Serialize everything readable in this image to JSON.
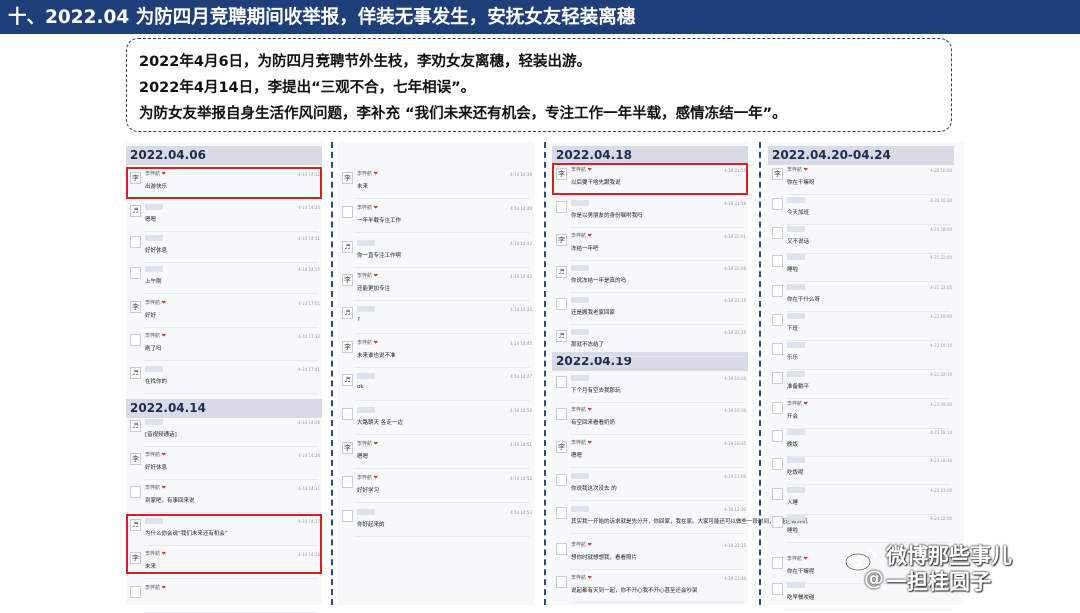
{
  "header": {
    "title": "十、2022.04  为防四月竞聘期间收举报，佯装无事发生，安抚女友轻装离穗"
  },
  "summary": {
    "line1": "2022年4月6日，为防四月竞聘节外生枝，李劝女友离穗，轻装出游。",
    "line2": "2022年4月14日，李提出“三观不合，七年相误”。",
    "line3": "为防女友举报自身生活作风问题，李补充 “我们未来还有机会，专注工作一年半载，感情冻结一年”。"
  },
  "dates": {
    "d1": "2022.04.06",
    "d2": "2022.04.14",
    "d3": "2022.04.18",
    "d4": "2022.04.19",
    "d5": "2022.04.20-04.24"
  },
  "sender": "李梓航",
  "columns": [
    {
      "messages": [
        {
          "name": "李梓航",
          "text": "出游快乐",
          "time": "4-14 14:32",
          "av": "李"
        },
        {
          "name": "",
          "text": "嗯嗯",
          "time": "4-14 14:35",
          "av": "♬"
        },
        {
          "name": "",
          "text": "好好休息",
          "time": "4-14 14:51",
          "av": ""
        },
        {
          "name": "",
          "text": "上午刚",
          "time": "4-14 14:55",
          "av": ""
        },
        {
          "name": "李梓航",
          "text": "好好",
          "time": "4-14 17:01",
          "av": "李"
        },
        {
          "name": "李梓航",
          "text": "刷了吗",
          "time": "4-14 17:32",
          "av": ""
        },
        {
          "name": "",
          "text": "在找你的",
          "time": "4-14 17:41",
          "av": "♬"
        },
        {
          "name": "",
          "text": "[音视频通话]",
          "time": "4-14 14:26",
          "av": "♬"
        },
        {
          "name": "李梓航",
          "text": "好好休息",
          "time": "4-14 14:28",
          "av": "李"
        },
        {
          "name": "李梓航",
          "text": "到家吧，有事回来说",
          "time": "4-14 14:31",
          "av": ""
        },
        {
          "name": "",
          "text": "为什么你会说“我们未来还有机会”",
          "time": "4-14 14:37",
          "av": "♬"
        },
        {
          "name": "李梓航",
          "text": "未来",
          "time": "4-14 14:38",
          "av": "李"
        },
        {
          "name": "李梓航",
          "text": "",
          "time": "",
          "av": ""
        }
      ]
    },
    {
      "messages": [
        {
          "name": "李梓航",
          "text": "未来",
          "time": "4-14 14:39",
          "av": "李"
        },
        {
          "name": "李梓航",
          "text": "一年半载专注工作",
          "time": "4-14 14:40",
          "av": ""
        },
        {
          "name": "",
          "text": "你一直专注工作啊",
          "time": "4-14 14:42",
          "av": "♬"
        },
        {
          "name": "李梓航",
          "text": "还能更加专注",
          "time": "4-14 14:43",
          "av": "李"
        },
        {
          "name": "",
          "text": "?",
          "time": "4-14 14:44",
          "av": "♬"
        },
        {
          "name": "李梓航",
          "text": "未来谁也说不准",
          "time": "4-14 14:45",
          "av": "李"
        },
        {
          "name": "",
          "text": "ok",
          "time": "4-14 14:47",
          "av": "♬"
        },
        {
          "name": "",
          "text": "大路朝天 各走一边",
          "time": "4-14 14:50",
          "av": ""
        },
        {
          "name": "李梓航",
          "text": "嗯嗯",
          "time": "4-14 14:51",
          "av": "李"
        },
        {
          "name": "李梓航",
          "text": "好好学习",
          "time": "4-14 14:52",
          "av": ""
        },
        {
          "name": "",
          "text": "你好起来的",
          "time": "4-14 14:53",
          "av": ""
        }
      ]
    },
    {
      "messages": [
        {
          "name": "李梓航",
          "text": "以后要干啥先跟我说",
          "time": "4-18 21:55",
          "av": "李"
        },
        {
          "name": "",
          "text": "你是以男朋友的身份嘱咐我吗",
          "time": "4-18 21:58",
          "av": ""
        },
        {
          "name": "李梓航",
          "text": "冻结一年吧",
          "time": "4-18 22:01",
          "av": "李"
        },
        {
          "name": "",
          "text": "你说冻结一年是真的吗",
          "time": "4-18 22:06",
          "av": "♬"
        },
        {
          "name": "",
          "text": "还是搬我老家回家",
          "time": "4-18 22:15",
          "av": ""
        },
        {
          "name": "",
          "text": "那就不冻结了",
          "time": "4-18 22:25",
          "av": "♬"
        },
        {
          "name": "",
          "text": "下个月有空去我那玩",
          "time": "4-19 10:20",
          "av": ""
        },
        {
          "name": "李梓航",
          "text": "有空回来看看奶奶",
          "time": "4-19 10:30",
          "av": ""
        },
        {
          "name": "李梓航",
          "text": "嗯嗯",
          "time": "4-19 10:35",
          "av": "李"
        },
        {
          "name": "",
          "text": "你说我这次没去        的",
          "time": "4-19 11:00",
          "av": ""
        },
        {
          "name": "",
          "text": "其实我一开始的诉求就是先分开，你回家，我在家。大家可能还可以做些一段时间，可能还有转机",
          "time": "4-19 12:30",
          "av": ""
        },
        {
          "name": "李梓航",
          "text": "想你时就想想我，看看照片",
          "time": "4-19 22:35",
          "av": ""
        },
        {
          "name": "李梓航",
          "text": "说起都有天到一起，你不开心我不开心甚至还会吵架",
          "time": "4-19 22:40",
          "av": ""
        }
      ]
    },
    {
      "messages": [
        {
          "name": "李梓航",
          "text": "你在干嘛呀",
          "time": "4-20 10:00",
          "av": "李"
        },
        {
          "name": "",
          "text": "今天加班",
          "time": "4-20 10:30",
          "av": ""
        },
        {
          "name": "",
          "text": "又不说话",
          "time": "4-20 18:00",
          "av": ""
        },
        {
          "name": "",
          "text": "睡啦",
          "time": "4-21 22:00",
          "av": ""
        },
        {
          "name": "",
          "text": "你在干什么呀",
          "time": "4-21 22:05",
          "av": ""
        },
        {
          "name": "",
          "text": "下班",
          "time": "4-22 19:00",
          "av": ""
        },
        {
          "name": "",
          "text": "乐乐",
          "time": "4-22 19:10",
          "av": ""
        },
        {
          "name": "",
          "text": "准备躺平",
          "time": "4-22 22:30",
          "av": ""
        },
        {
          "name": "李梓航",
          "text": "开会",
          "time": "4-23 09:20",
          "av": ""
        },
        {
          "name": "",
          "text": "晚饭",
          "time": "4-23 18:10",
          "av": ""
        },
        {
          "name": "",
          "text": "吃饭呢",
          "time": "4-23 18:30",
          "av": ""
        },
        {
          "name": "",
          "text": "入睡",
          "time": "4-23 23:00",
          "av": ""
        },
        {
          "name": "",
          "text": "睡啦",
          "time": "4-24 22:00",
          "av": ""
        },
        {
          "name": "李梓航",
          "text": "你在干嘛呢",
          "time": "4-24 22:10",
          "av": ""
        },
        {
          "name": "",
          "text": "吃早餐咬碰",
          "time": "4-24 08:30",
          "av": ""
        }
      ]
    }
  ],
  "watermark": {
    "line1": "微博那些事儿",
    "line2": "一担桂圆子"
  }
}
